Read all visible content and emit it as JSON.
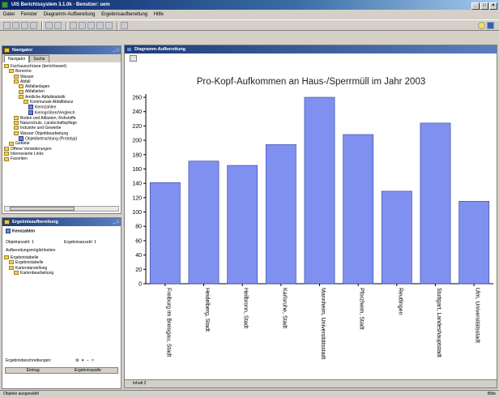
{
  "window": {
    "title": "UIS Berichtssystem 3.1.0k · Benutzer: uem"
  },
  "menu": [
    "Datei",
    "Fenster",
    "Diagramm-Aufbereitung",
    "Ergebnisaufbereitung",
    "Hilfe"
  ],
  "navigator": {
    "title": "Navigator",
    "tabs": [
      "Navigator",
      "Suche"
    ],
    "tree": [
      {
        "label": "Fachausschüsse (berichtswert)",
        "depth": 0,
        "kind": "folder"
      },
      {
        "label": "Bereiche",
        "depth": 1,
        "kind": "folder"
      },
      {
        "label": "Wasser",
        "depth": 2,
        "kind": "folder"
      },
      {
        "label": "Abfall",
        "depth": 2,
        "kind": "folder"
      },
      {
        "label": "Abfallanlagen",
        "depth": 3,
        "kind": "folder"
      },
      {
        "label": "Abfallarten",
        "depth": 3,
        "kind": "folder"
      },
      {
        "label": "Amtliche Abfallstatistik",
        "depth": 3,
        "kind": "folder"
      },
      {
        "label": "Kommunale Abfallbilanz",
        "depth": 4,
        "kind": "folder"
      },
      {
        "label": "Kennzahlen",
        "depth": 5,
        "kind": "doc"
      },
      {
        "label": "Kenngrößen/Vergleich",
        "depth": 5,
        "kind": "doc"
      },
      {
        "label": "Boden und Altlasten, Rohstoffe",
        "depth": 2,
        "kind": "folder"
      },
      {
        "label": "Naturschutz, Landschaftspflege",
        "depth": 2,
        "kind": "folder"
      },
      {
        "label": "Industrie und Gewerbe",
        "depth": 2,
        "kind": "folder"
      },
      {
        "label": "Wasser Objektbearbeitung",
        "depth": 2,
        "kind": "folder"
      },
      {
        "label": "Objektbetrachtung (Prototyp)",
        "depth": 3,
        "kind": "doc"
      },
      {
        "label": "Gebiete",
        "depth": 1,
        "kind": "folder"
      },
      {
        "label": "Offene Veränderungen",
        "depth": 0,
        "kind": "folder"
      },
      {
        "label": "Interessierte Links",
        "depth": 0,
        "kind": "folder"
      },
      {
        "label": "Favoriten",
        "depth": 0,
        "kind": "folder"
      }
    ]
  },
  "results": {
    "title": "Ergebnisaufbereitung",
    "selected": "Kennzahlen",
    "objektanzahl": "Objektanzahl: 1",
    "ergebnisanzahl": "Ergebnisanzahl: 1",
    "aufbereitung": "Aufbereitungsmöglichkeiten",
    "tree": [
      {
        "label": "Ergebnistabelle",
        "depth": 0
      },
      {
        "label": "Ergebnistabelle",
        "depth": 1
      },
      {
        "label": "Kartendarstellung",
        "depth": 1
      },
      {
        "label": "Kartenbearbeitung",
        "depth": 2
      }
    ],
    "notes_label": "Ergebnisbeschreibungen:",
    "notes_cols": [
      "Eintrag",
      "Ergebnisspalte"
    ]
  },
  "diagram": {
    "title": "Diagramm-Aufbereitung",
    "bottom_tab": "Inhalt 2"
  },
  "status": {
    "left": "Objekte ausgewählt",
    "right": "Bitte"
  },
  "chart_data": {
    "type": "bar",
    "title": "Pro-Kopf-Aufkommen an Haus-/Sperrmüll im Jahr 2003",
    "categories": [
      "Freiburg im Breisgau, Stadt",
      "Heidelberg, Stadt",
      "Heilbronn, Stadt",
      "Karlsruhe, Stadt",
      "Mannheim, Universitätsstadt",
      "Pforzheim, Stadt",
      "Reutlingen",
      "Stuttgart, Landeshauptstadt",
      "Ulm, Universitätsstadt"
    ],
    "values": [
      141,
      171,
      165,
      194,
      260,
      208,
      129,
      224,
      115
    ],
    "ylim": [
      0,
      260
    ],
    "yticks": [
      0,
      20,
      40,
      60,
      80,
      100,
      120,
      140,
      160,
      180,
      200,
      220,
      240,
      260
    ],
    "bar_color": "#8090f0"
  }
}
